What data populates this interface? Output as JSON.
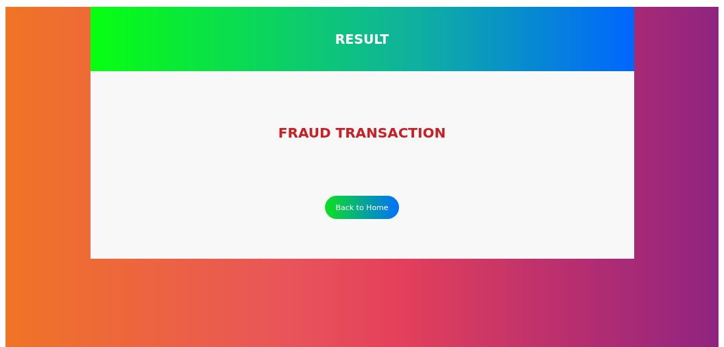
{
  "header": {
    "title": "RESULT"
  },
  "result": {
    "text": "FRAUD TRANSACTION",
    "kind": "fraud"
  },
  "button": {
    "label": "Back to Home"
  }
}
